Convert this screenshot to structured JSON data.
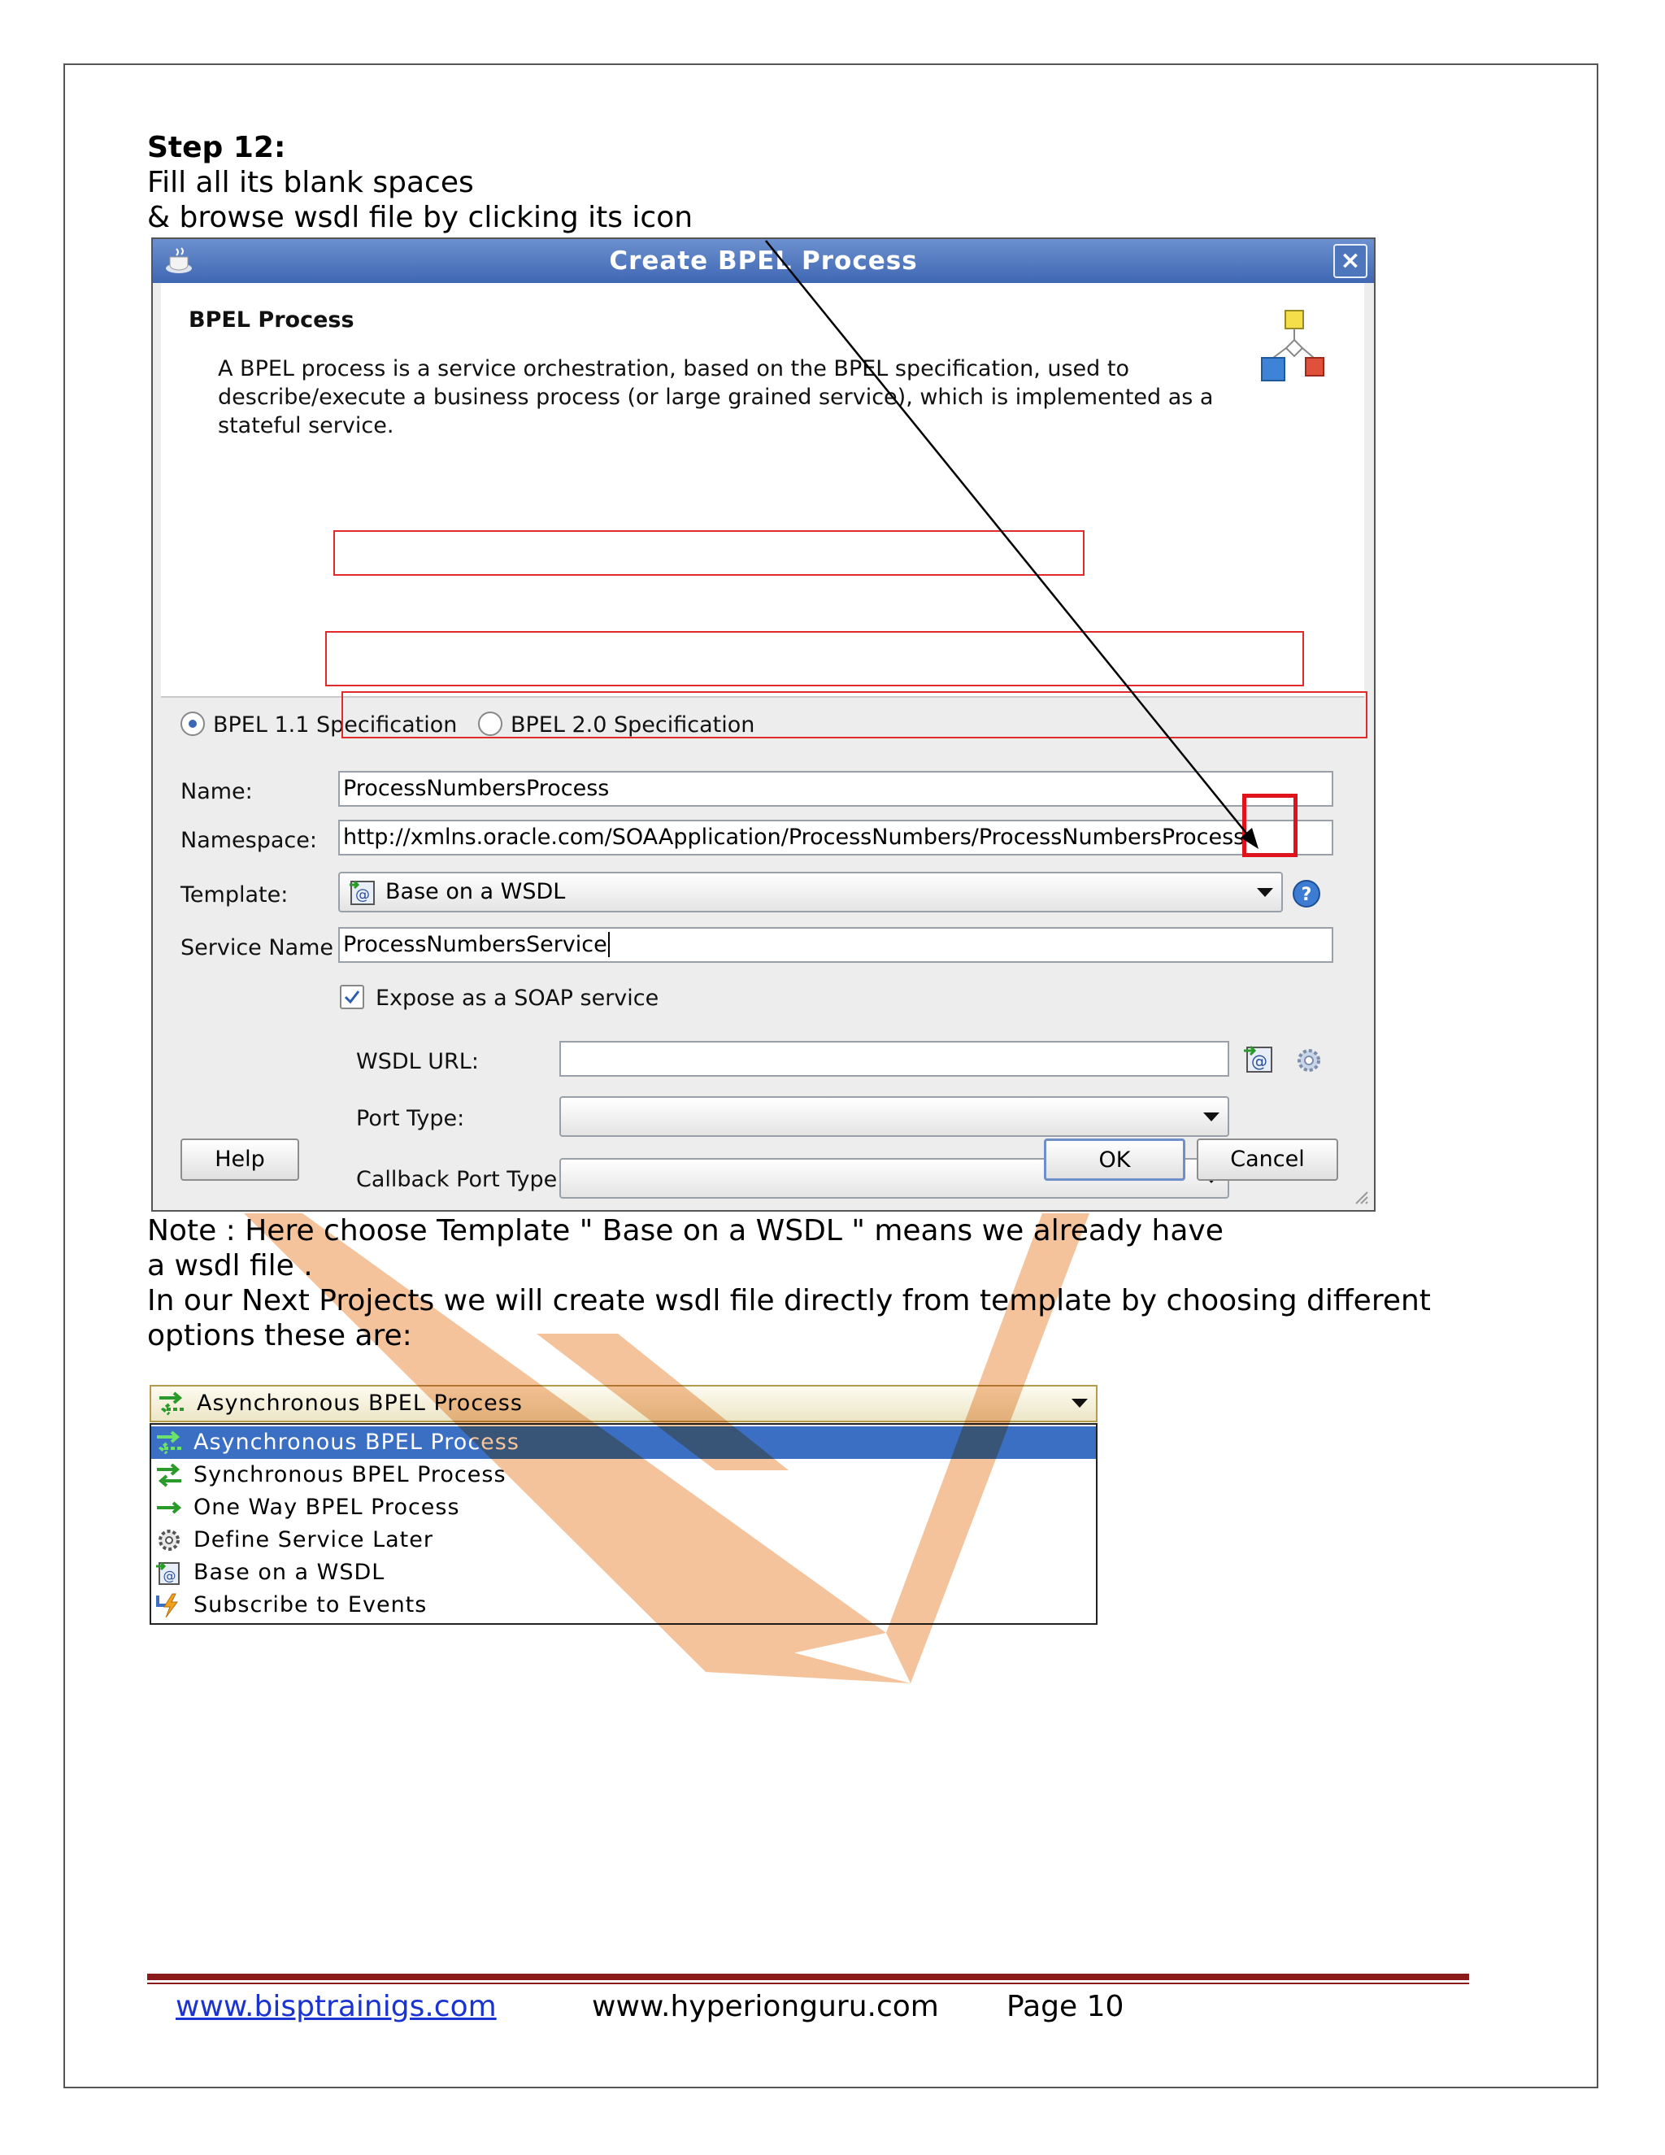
{
  "document": {
    "step_title": "Step 12:",
    "instruction_line1": "Fill all its blank spaces",
    "instruction_line2": "& browse wsdl file by clicking its icon",
    "note_line1": "Note : Here choose Template  \" Base on  a WSDL \"  means we  already have",
    "note_line2": "a wsdl file .",
    "note_line3": "In our Next Projects we will create wsdl file directly from template by choosing different",
    "note_line4": "options these are:"
  },
  "dialog": {
    "title": "Create BPEL Process",
    "close_label": "×",
    "header_title": "BPEL Process",
    "header_desc_line1": "A BPEL process is a service orchestration, based on the BPEL specification, used to",
    "header_desc_line2": "describe/execute a business process (or large grained service), which is implemented as a",
    "header_desc_line3": "stateful service.",
    "spec_options": [
      "BPEL 1.1 Specification",
      "BPEL 2.0 Specification"
    ],
    "selected_spec": "BPEL 1.1 Specification",
    "name_label": "Name:",
    "name_value": "ProcessNumbersProcess",
    "namespace_label": "Namespace:",
    "namespace_value": "http://xmlns.oracle.com/SOAApplication/ProcessNumbers/ProcessNumbersProcess",
    "template_label": "Template:",
    "template_value": "Base on a WSDL",
    "service_name_label": "Service Name",
    "service_name_value": "ProcessNumbersService",
    "expose_soap_label": "Expose as a SOAP service",
    "expose_soap_checked": true,
    "wsdl_url_label": "WSDL URL:",
    "wsdl_url_value": "",
    "port_type_label": "Port Type:",
    "port_type_value": "",
    "callback_port_type_label": "Callback Port Type:",
    "callback_port_type_value": "",
    "help_label": "Help",
    "ok_label": "OK",
    "cancel_label": "Cancel"
  },
  "template_dropdown": {
    "selected": "Asynchronous BPEL Process",
    "options": [
      {
        "label": "Asynchronous BPEL Process",
        "icon": "async-arrows-icon"
      },
      {
        "label": "Synchronous BPEL Process",
        "icon": "sync-arrows-icon"
      },
      {
        "label": "One Way BPEL Process",
        "icon": "one-way-arrow-icon"
      },
      {
        "label": "Define Service Later",
        "icon": "gear-icon"
      },
      {
        "label": "Base on a WSDL",
        "icon": "wsdl-icon"
      },
      {
        "label": "Subscribe to Events",
        "icon": "lightning-icon"
      }
    ]
  },
  "footer": {
    "link1": "www.bisptrainigs.com",
    "site2": "www.hyperionguru.com",
    "page": "Page 10"
  },
  "colors": {
    "watermark": "#f2b98a",
    "annotation_red": "#e12a2a",
    "title_bar": "#4f77bd",
    "selection": "#3a6fc4",
    "footer_rule": "#8b1a1a",
    "link": "#1a33d1"
  }
}
